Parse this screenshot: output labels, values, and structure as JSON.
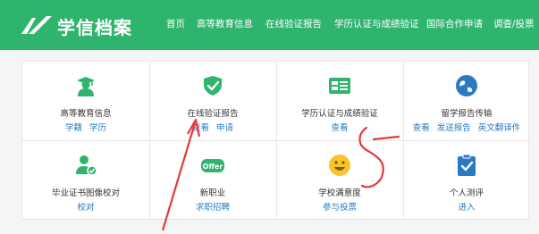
{
  "header": {
    "logo_text": "学信档案",
    "nav": [
      "首页",
      "高等教育信息",
      "在线验证报告",
      "学历认证与成绩验证",
      "国际合作申请",
      "调查/投票"
    ]
  },
  "cards": [
    {
      "title": "高等教育信息",
      "icon": "graduate-icon",
      "links": [
        "学籍",
        "学历"
      ]
    },
    {
      "title": "在线验证报告",
      "icon": "shield-check-icon",
      "links": [
        "查看",
        "申请"
      ]
    },
    {
      "title": "学历认证与成绩验证",
      "icon": "id-card-icon",
      "links": [
        "查看"
      ]
    },
    {
      "title": "留学报告传输",
      "icon": "globe-icon",
      "links": [
        "查看",
        "发送报告",
        "英文翻译件"
      ]
    },
    {
      "title": "毕业证书图像校对",
      "icon": "user-check-icon",
      "links": [
        "校对"
      ]
    },
    {
      "title": "新职业",
      "icon": "offer-badge-icon",
      "badge_text": "Offer",
      "links": [
        "求职招聘"
      ]
    },
    {
      "title": "学校满意度",
      "icon": "smiley-icon",
      "links": [
        "参与投票"
      ]
    },
    {
      "title": "个人测评",
      "icon": "clipboard-check-icon",
      "links": [
        "进入"
      ]
    }
  ],
  "colors": {
    "brand_green": "#2fb46e",
    "link_blue": "#2b79c2",
    "annotation_red": "#e23b3b",
    "smiley_yellow": "#f7c52b"
  }
}
